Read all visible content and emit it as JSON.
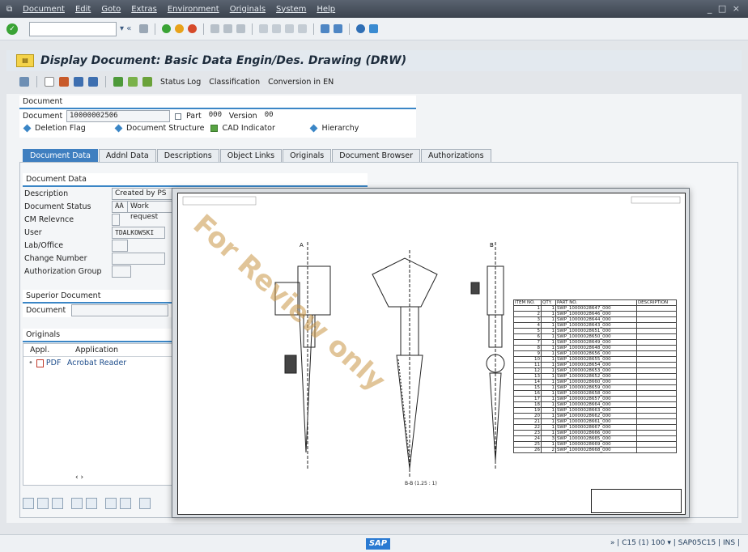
{
  "menubar": {
    "items": [
      "Document",
      "Edit",
      "Goto",
      "Extras",
      "Environment",
      "Originals",
      "System",
      "Help"
    ],
    "window_controls": "_ □ ×"
  },
  "title": "Display Document: Basic Data Engin/Des. Drawing (DRW)",
  "toolbar": {
    "status_log": "Status Log",
    "classification": "Classification",
    "conversion": "Conversion in EN"
  },
  "document": {
    "group_title": "Document",
    "doc_label": "Document",
    "doc_value": "10000002506",
    "part_label": "Part",
    "part_value": "000",
    "version_label": "Version",
    "version_value": "00",
    "deletion_flag": "Deletion Flag",
    "structure": "Document Structure",
    "cad": "CAD Indicator",
    "hierarchy": "Hierarchy"
  },
  "tabs": [
    "Document Data",
    "Addnl Data",
    "Descriptions",
    "Object Links",
    "Originals",
    "Document Browser",
    "Authorizations"
  ],
  "docdata": {
    "group_title": "Document Data",
    "description_label": "Description",
    "description_value": "Created by PS",
    "status_label": "Document Status",
    "status_code": "AA",
    "status_text": "Work request",
    "cm_label": "CM Relevnce",
    "user_label": "User",
    "user_value": "TDALKOWSKI",
    "lab_label": "Lab/Office",
    "change_label": "Change Number",
    "auth_label": "Authorization Group"
  },
  "superior": {
    "group_title": "Superior Document",
    "doc_label": "Document"
  },
  "originals": {
    "group_title": "Originals",
    "col_appl": "Appl.",
    "col_application": "Application",
    "row_appl": "PDF",
    "row_application": "Acrobat Reader"
  },
  "drawing": {
    "watermark": "For Review only",
    "section_label": "B-B (1.25 : 1)",
    "bom_headers": [
      "ITEM NO.",
      "QTY.",
      "PART NO.",
      "DESCRIPTION"
    ],
    "bom_rows": [
      [
        "1",
        "1",
        "SWP_10000028647_000"
      ],
      [
        "2",
        "1",
        "SWP_10000028646_000"
      ],
      [
        "3",
        "1",
        "SWP_10000028644_000"
      ],
      [
        "4",
        "1",
        "SWP_10000028643_000"
      ],
      [
        "5",
        "1",
        "SWP_10000028651_000"
      ],
      [
        "6",
        "1",
        "SWP_10000028650_000"
      ],
      [
        "7",
        "1",
        "SWP_10000028649_000"
      ],
      [
        "8",
        "1",
        "SWP_10000028648_000"
      ],
      [
        "9",
        "1",
        "SWP_10000028656_000"
      ],
      [
        "10",
        "1",
        "SWP_10000028655_000"
      ],
      [
        "11",
        "1",
        "SWP_10000028654_000"
      ],
      [
        "12",
        "1",
        "SWP_10000028653_000"
      ],
      [
        "13",
        "1",
        "SWP_10000028652_000"
      ],
      [
        "14",
        "1",
        "SWP_10000028660_000"
      ],
      [
        "15",
        "1",
        "SWP_10000028659_000"
      ],
      [
        "16",
        "1",
        "SWP_10000028658_000"
      ],
      [
        "17",
        "1",
        "SWP_10000028657_000"
      ],
      [
        "18",
        "1",
        "SWP_10000028664_000"
      ],
      [
        "19",
        "1",
        "SWP_10000028663_000"
      ],
      [
        "20",
        "1",
        "SWP_10000028662_000"
      ],
      [
        "21",
        "1",
        "SWP_10000028661_000"
      ],
      [
        "22",
        "1",
        "SWP_10000028667_000"
      ],
      [
        "23",
        "1",
        "SWP_10000028666_000"
      ],
      [
        "24",
        "3",
        "SWP_10000028665_000"
      ],
      [
        "25",
        "1",
        "SWP_10000028669_000"
      ],
      [
        "26",
        "2",
        "SWP_10000028668_000"
      ]
    ]
  },
  "statusbar": {
    "sap": "SAP",
    "info": "» | C15 (1) 100 ▾ | SAP05C15 | INS |"
  },
  "colors": {
    "accent": "#3b86c6",
    "menubar": "#3b434e",
    "watermark": "#c8964a"
  }
}
